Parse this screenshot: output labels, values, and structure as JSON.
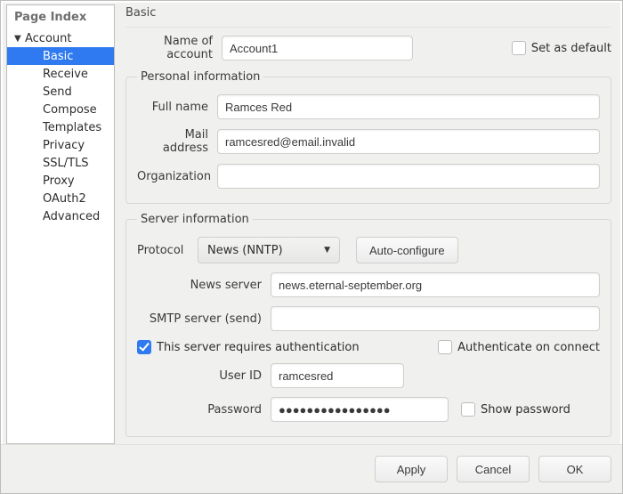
{
  "sidebar": {
    "title": "Page Index",
    "root": {
      "label": "Account",
      "expanded": true
    },
    "items": [
      {
        "label": "Basic",
        "selected": true
      },
      {
        "label": "Receive",
        "selected": false
      },
      {
        "label": "Send",
        "selected": false
      },
      {
        "label": "Compose",
        "selected": false
      },
      {
        "label": "Templates",
        "selected": false
      },
      {
        "label": "Privacy",
        "selected": false
      },
      {
        "label": "SSL/TLS",
        "selected": false
      },
      {
        "label": "Proxy",
        "selected": false
      },
      {
        "label": "OAuth2",
        "selected": false
      },
      {
        "label": "Advanced",
        "selected": false
      }
    ]
  },
  "panel": {
    "title": "Basic",
    "name_label": "Name of account",
    "name_value": "Account1",
    "set_default_label": "Set as default",
    "set_default_checked": false
  },
  "personal": {
    "legend": "Personal information",
    "fullname_label": "Full name",
    "fullname_value": "Ramces Red",
    "mail_label": "Mail address",
    "mail_value": "ramcesred@email.invalid",
    "org_label": "Organization",
    "org_value": ""
  },
  "server": {
    "legend": "Server information",
    "protocol_label": "Protocol",
    "protocol_value": "News (NNTP)",
    "autoconf_label": "Auto-configure",
    "news_label": "News server",
    "news_value": "news.eternal-september.org",
    "smtp_label": "SMTP server (send)",
    "smtp_value": "",
    "auth_label": "This server requires authentication",
    "auth_checked": true,
    "auth_connect_label": "Authenticate on connect",
    "auth_connect_checked": false,
    "userid_label": "User ID",
    "userid_value": "ramcesred",
    "password_label": "Password",
    "password_value": "●●●●●●●●●●●●●●●●",
    "showpw_label": "Show password",
    "showpw_checked": false
  },
  "footer": {
    "apply": "Apply",
    "cancel": "Cancel",
    "ok": "OK"
  }
}
